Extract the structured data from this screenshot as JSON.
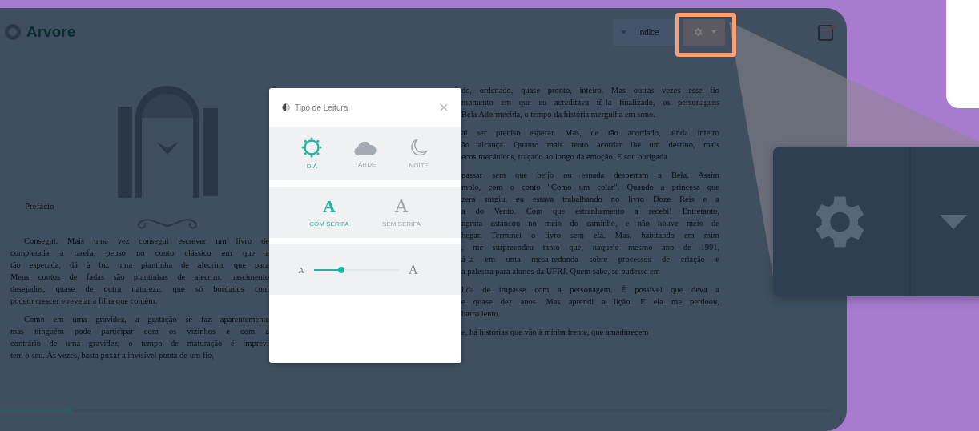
{
  "header": {
    "logo": "Arvore",
    "chapter_select": "Índice"
  },
  "book": {
    "left_heading": "Prefácio",
    "left_paragraphs": [
      [
        "Consegui. Mais uma vez consegui escrever um livro de",
        "completada a tarefa, penso no conto clássico em que a",
        "tão esperada, dá à luz uma plantinha de alecrim, que para",
        "Meus contos de fadas são plantinhas de alecrim, nascimento",
        "desejados, quase de outra natureza, que só bordados com",
        "podem crescer e revelar a filha que contêm."
      ],
      [
        "Como em uma gravidez, a gestação se faz aparentemente",
        "mas ninguém pode participar com os vizinhos e com a",
        "contrário de uma gravidez, o tempo de maturação é imprevi",
        "tem o seu. Às vezes, basta puxar a invisível ponta de um fio,"
      ]
    ],
    "right_paragraphs": [
      [
        "do, ordenado, quase pronto, inteiro. Mas outras vezes esse fio",
        "momento em que eu acreditava tê-la finalizado, os personagens",
        "Bela Adormecida, o tempo da história mergulha em sono."
      ],
      [
        "ai ser preciso esperar. Mas, de tão acordado, ainda inteiro",
        "ão alcança. Quanto mais tento acordar lhe um destino, mais",
        "ecos mecânicos, traçado ao longo da emoção. E sou obrigada"
      ],
      [
        "passar sem que beijo ou espada despertam a Bela. Assim",
        "mplo, com o conto \"Como um colar\". Quando a princesa que",
        "zera surgiu, eu estava trabalhando no livro Doze Reis e a",
        "a do Vento. Com que estranhamento a recebi! Entretanto,",
        "ngrata estancou no meio do caminho, e não houve meio de",
        "hegar. Terminei o livro sem ela. Mas, habitando em mim",
        ", me surpreendeu tanto que, naquele mesmo ano de 1991,",
        "á-la em uma mesa-redonda sobre processos de criação e",
        "a palestra para alunos da UFRJ. Quem sabe, se pudesse em"
      ],
      [
        "lida de impasse com a personagem. É possível que deva a",
        "e quase dez anos. Mas aprendi a lição. E ela me perdoou,",
        "barro lento."
      ],
      [
        "e, há histórias que vão à minha frente, que amadurecem"
      ]
    ]
  },
  "progress": {
    "level": 0.082
  },
  "reading_modal": {
    "title": "Tipo de Leitura",
    "themes": [
      {
        "label": "DIA",
        "kind": "sun",
        "selected": true
      },
      {
        "label": "TARDE",
        "kind": "cloud",
        "selected": false
      },
      {
        "label": "NOITE",
        "kind": "moon",
        "selected": false
      }
    ],
    "fonts": [
      {
        "label": "COM SERIFA",
        "glyph": "A",
        "kind": "serif",
        "selected": true
      },
      {
        "label": "SEM SERIFA",
        "glyph": "A",
        "kind": "sans",
        "selected": false
      }
    ],
    "font_size": {
      "min_glyph": "A",
      "max_glyph": "A",
      "level": 0.32
    }
  }
}
